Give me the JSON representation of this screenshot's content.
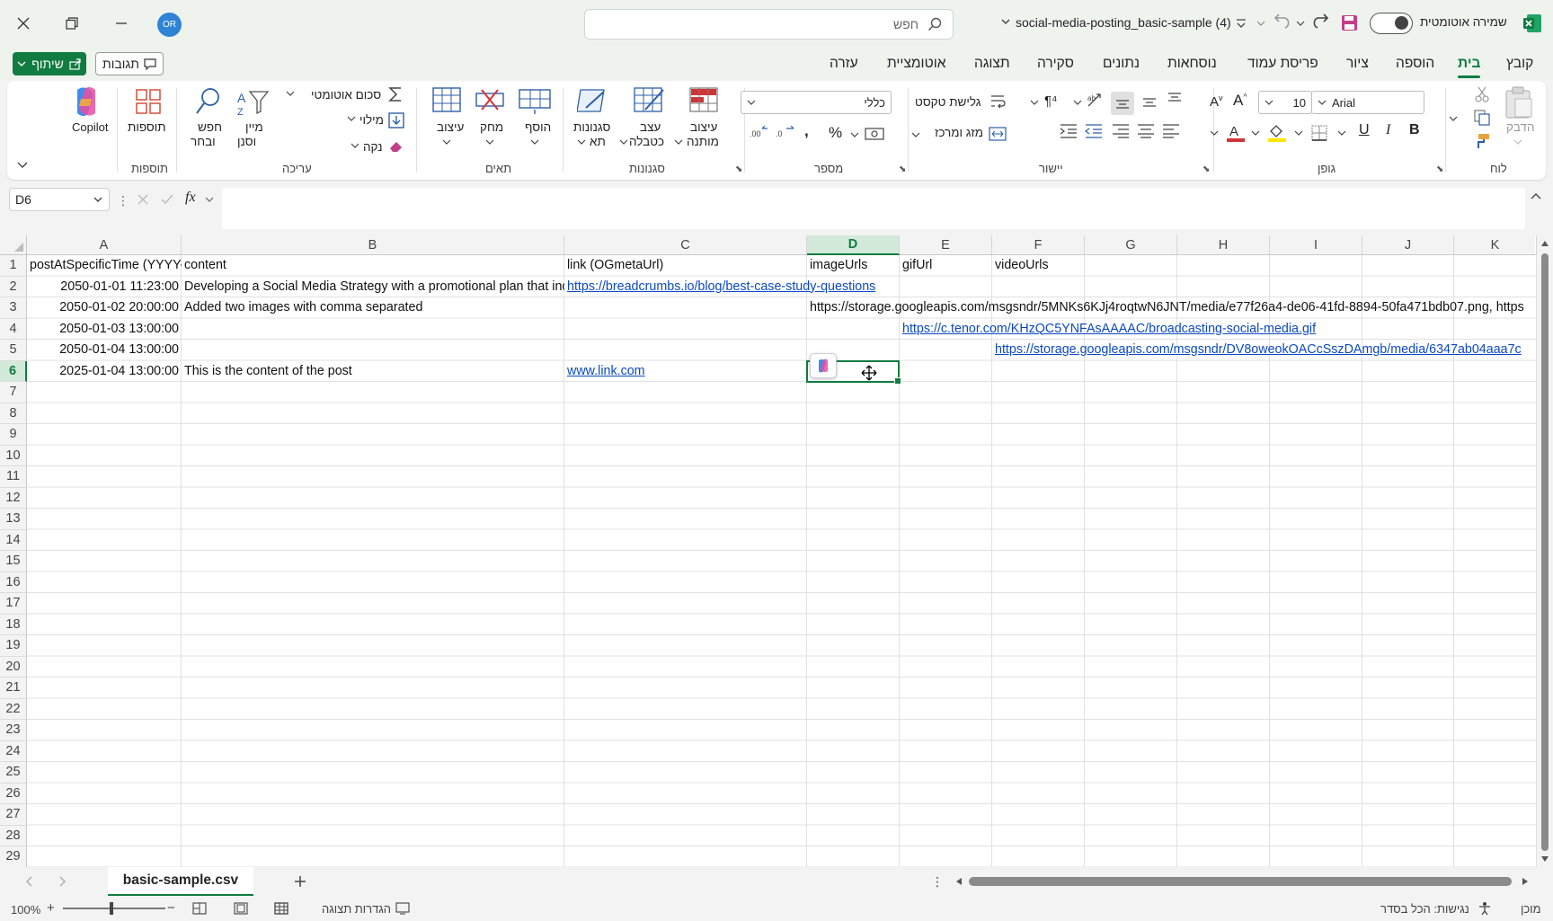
{
  "window": {
    "file_title": "social-media-posting_basic-sample (4)",
    "autosave_label": "שמירה אוטומטית",
    "autosave_on": true,
    "search_placeholder": "חפש",
    "user_initials": "OR"
  },
  "tabs": [
    "קובץ",
    "בית",
    "הוספה",
    "ציור",
    "פריסת עמוד",
    "נוסחאות",
    "נתונים",
    "סקירה",
    "תצוגה",
    "אוטומציית",
    "עזרה"
  ],
  "active_tab": "בית",
  "share_label": "שיתוף",
  "comments_label": "תגובות",
  "ribbon": {
    "groups": {
      "clipboard": "לוח",
      "font": "גופן",
      "alignment": "יישור",
      "number": "מספר",
      "styles": "סגנונות",
      "cells": "תאים",
      "editing": "עריכה",
      "addins": "תוספות"
    },
    "paste_label": "הדבק",
    "font_name": "Arial",
    "font_size": "10",
    "wrap_text": "גלישת טקסט",
    "merge_center": "מזג ומרכז",
    "number_format": "כללי",
    "conditional_formatting": [
      "עיצוב",
      "מותנה"
    ],
    "format_as_table": [
      "עצב",
      "כטבלה"
    ],
    "cell_styles": [
      "סגנונות",
      "תא"
    ],
    "insert_label": "הוסף",
    "delete_label": "מחק",
    "format_label": "עיצוב",
    "autosum_label": "סכום אוטומטי",
    "fill_label": "מילוי",
    "clear_label": "נקה",
    "sort_filter": [
      "מיין",
      "וסנן"
    ],
    "find_select": [
      "חפש",
      "ובחר"
    ],
    "addins_label": "תוספות",
    "copilot_label": "Copilot"
  },
  "name_box": "D6",
  "formula_value": "",
  "columns": [
    "A",
    "B",
    "C",
    "D",
    "E",
    "F",
    "G",
    "H",
    "I",
    "J",
    "K"
  ],
  "selected_column": "D",
  "rows": [
    "1",
    "2",
    "3",
    "4",
    "5",
    "6",
    "7",
    "8",
    "9",
    "10",
    "11",
    "12",
    "13",
    "14",
    "15",
    "16",
    "17",
    "18",
    "19",
    "20",
    "21",
    "22",
    "23",
    "24",
    "25",
    "26",
    "27",
    "28",
    "29"
  ],
  "selected_row": "6",
  "cells": {
    "A1": "postAtSpecificTime (YYYY-MM-DD HH:MM:SS)",
    "B1": "content",
    "C1": "link (OGmetaUrl)",
    "D1": "imageUrls",
    "E1": "gifUrl",
    "F1": "videoUrls",
    "A2": "2050-01-01 11:23:00",
    "B2": "Developing a Social Media Strategy with a promotional plan that includes",
    "C2": "https://breadcrumbs.io/blog/best-case-study-questions",
    "A3": "2050-01-02 20:00:00",
    "B3": "Added two images with comma separated",
    "D3": "https://storage.googleapis.com/msgsndr/5MNKs6KJj4roqtwN6JNT/media/e77f26a4-de06-41fd-8894-50fa471bdb07.png, https",
    "A4": "2050-01-03 13:00:00",
    "E4": "https://c.tenor.com/KHzQC5YNFAsAAAAC/broadcasting-social-media.gif",
    "A5": "2050-01-04 13:00:00",
    "F5": "https://storage.googleapis.com/msgsndr/DV8oweokOACcSszDAmgb/media/6347ab04aaa7c",
    "A6": "2025-01-04 13:00:00",
    "B6": "This is the content of the post",
    "C6": "www.link.com"
  },
  "sheet_tab": "basic-sample.csv",
  "status": {
    "ready": "מוכן",
    "accessibility": "נגישות: הכל בסדר",
    "display_settings": "הגדרות תצוגה",
    "zoom": "100%"
  },
  "colors": {
    "accent": "#107c41",
    "link": "#0b49c4"
  }
}
